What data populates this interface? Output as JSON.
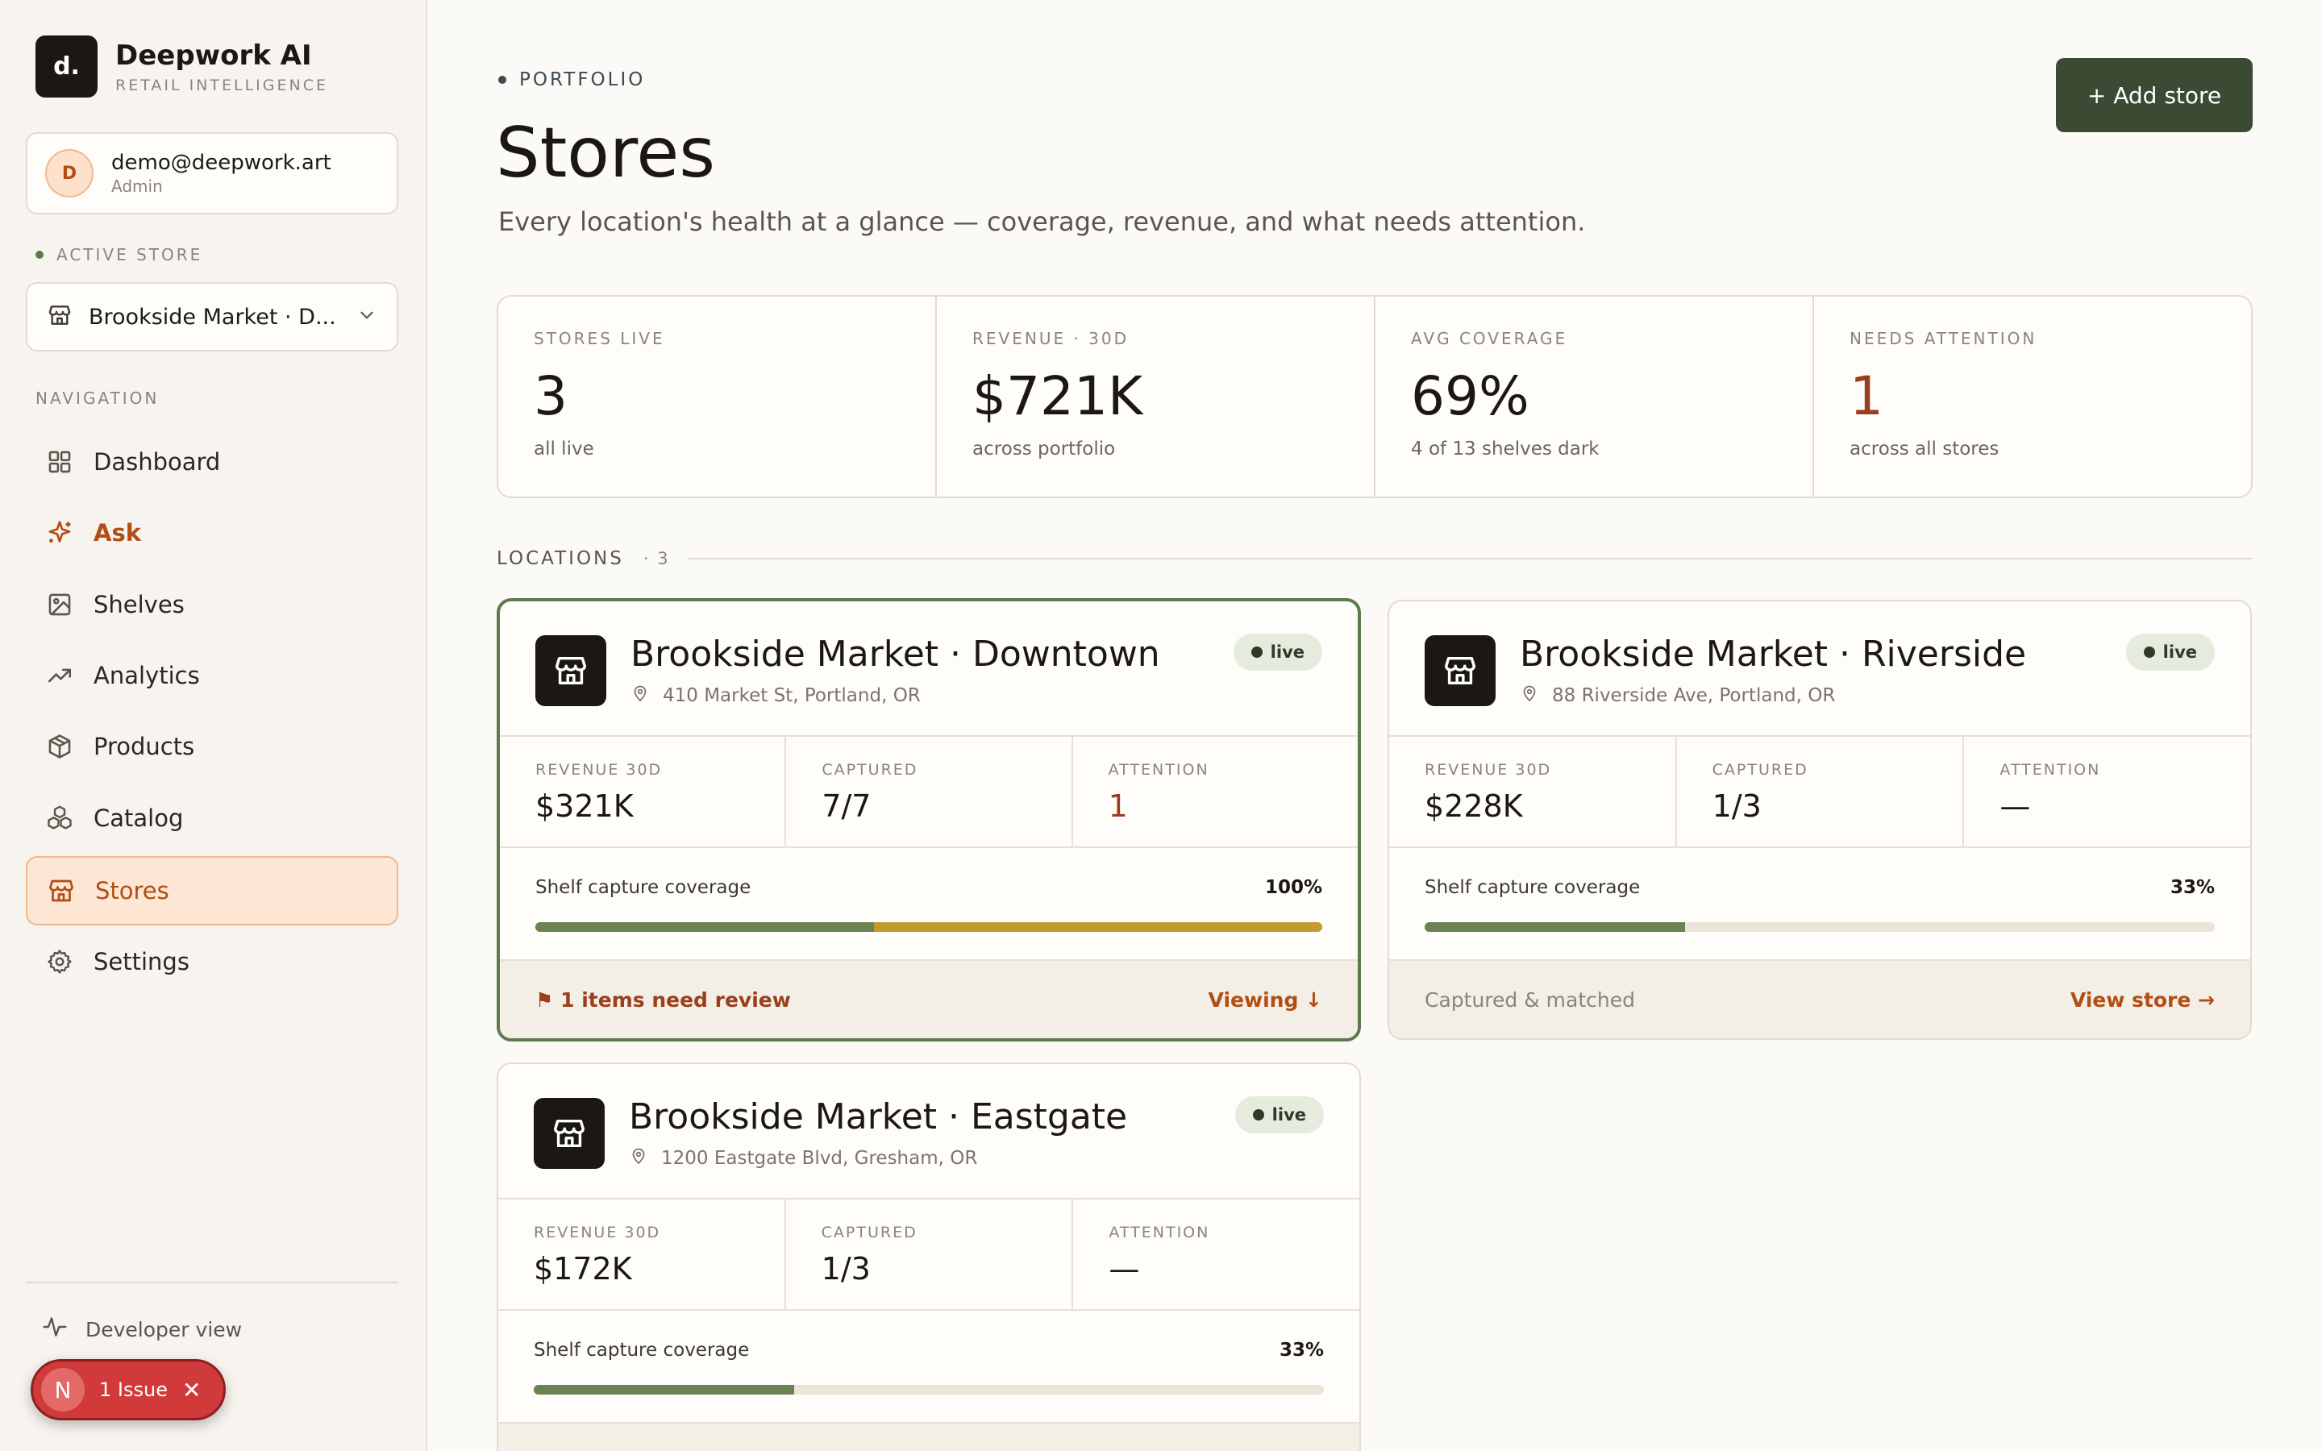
{
  "brand": {
    "logo": "d.",
    "name": "Deepwork AI",
    "tagline": "RETAIL INTELLIGENCE"
  },
  "user": {
    "initial": "D",
    "email": "demo@deepwork.art",
    "role": "Admin"
  },
  "active_store": {
    "label": "ACTIVE STORE",
    "value": "Brookside Market · D..."
  },
  "navigation": {
    "label": "NAVIGATION",
    "items": [
      {
        "label": "Dashboard",
        "icon": "grid-icon"
      },
      {
        "label": "Ask",
        "icon": "sparkle-icon"
      },
      {
        "label": "Shelves",
        "icon": "image-icon"
      },
      {
        "label": "Analytics",
        "icon": "trend-icon"
      },
      {
        "label": "Products",
        "icon": "box-icon"
      },
      {
        "label": "Catalog",
        "icon": "boxes-icon"
      },
      {
        "label": "Stores",
        "icon": "store-icon",
        "active": true
      },
      {
        "label": "Settings",
        "icon": "gear-icon"
      }
    ]
  },
  "developer_view": "Developer view",
  "issue_pill": {
    "initial": "N",
    "text": "1 Issue",
    "close": "✕"
  },
  "header": {
    "eyebrow": "PORTFOLIO",
    "title": "Stores",
    "subtitle": "Every location's health at a glance — coverage, revenue, and what needs attention.",
    "add_button": "+ Add store"
  },
  "stats": [
    {
      "label": "STORES LIVE",
      "value": "3",
      "note": "all live"
    },
    {
      "label": "REVENUE · 30D",
      "value": "$721K",
      "note": "across portfolio"
    },
    {
      "label": "AVG COVERAGE",
      "value": "69%",
      "note": "4 of 13 shelves dark"
    },
    {
      "label": "NEEDS ATTENTION",
      "value": "1",
      "note": "across all stores"
    }
  ],
  "locations": {
    "title": "LOCATIONS",
    "count": "· 3",
    "cards": [
      {
        "name": "Brookside Market · Downtown",
        "address": "410 Market St, Portland, OR",
        "status": "live",
        "metrics": [
          {
            "label": "REVENUE 30D",
            "value": "$321K"
          },
          {
            "label": "CAPTURED",
            "value": "7/7"
          },
          {
            "label": "ATTENTION",
            "value": "1"
          }
        ],
        "coverage_label": "Shelf capture coverage",
        "coverage_pct": "100%",
        "coverage_matched": 0.43,
        "coverage_total": 1.0,
        "footer_left": "⚑ 1 items need review",
        "footer_right": "Viewing ↓"
      },
      {
        "name": "Brookside Market · Riverside",
        "address": "88 Riverside Ave, Portland, OR",
        "status": "live",
        "metrics": [
          {
            "label": "REVENUE 30D",
            "value": "$228K"
          },
          {
            "label": "CAPTURED",
            "value": "1/3"
          },
          {
            "label": "ATTENTION",
            "value": "—"
          }
        ],
        "coverage_label": "Shelf capture coverage",
        "coverage_pct": "33%",
        "coverage_matched": 0.33,
        "coverage_total": 0.33,
        "footer_left": "Captured & matched",
        "footer_right": "View store →"
      },
      {
        "name": "Brookside Market · Eastgate",
        "address": "1200 Eastgate Blvd, Gresham, OR",
        "status": "live",
        "metrics": [
          {
            "label": "REVENUE 30D",
            "value": "$172K"
          },
          {
            "label": "CAPTURED",
            "value": "1/3"
          },
          {
            "label": "ATTENTION",
            "value": "—"
          }
        ],
        "coverage_label": "Shelf capture coverage",
        "coverage_pct": "33%",
        "coverage_matched": 0.33,
        "coverage_total": 0.33
      }
    ]
  },
  "colors": {
    "accent": "#b24d14",
    "primary_button": "#3d4a33",
    "coverage_matched": "#6b8254",
    "coverage_unmatched": "#c29a2e",
    "warning_text": "#9a3e1c"
  }
}
